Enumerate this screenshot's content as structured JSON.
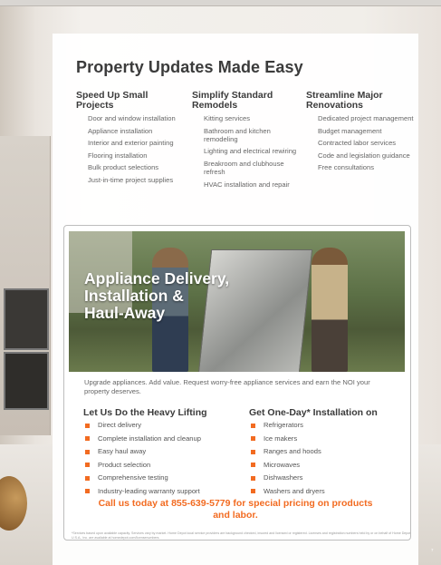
{
  "title": "Property Updates Made Easy",
  "columns": [
    {
      "heading": "Speed Up Small Projects",
      "items": [
        "Door and window installation",
        "Appliance installation",
        "Interior and exterior painting",
        "Flooring installation",
        "Bulk product selections",
        "Just-in-time project supplies"
      ]
    },
    {
      "heading": "Simplify Standard Remodels",
      "items": [
        "Kitting services",
        "Bathroom and kitchen remodeling",
        "Lighting and electrical rewiring",
        "Breakroom and clubhouse refresh",
        "HVAC installation and repair"
      ]
    },
    {
      "heading": "Streamline Major Renovations",
      "items": [
        "Dedicated project management",
        "Budget management",
        "Contracted labor services",
        "Code and legislation guidance",
        "Free consultations"
      ]
    }
  ],
  "feature": {
    "headline": [
      "Appliance Delivery,",
      "Installation &",
      "Haul-Away"
    ],
    "intro": "Upgrade appliances. Add value. Request worry-free appliance services and earn the NOI your property deserves.",
    "left": {
      "heading": "Let Us Do the Heavy Lifting",
      "items": [
        "Direct delivery",
        "Complete installation and cleanup",
        "Easy haul away",
        "Product selection",
        "Comprehensive testing",
        "Industry-leading warranty support"
      ]
    },
    "right": {
      "heading": "Get One-Day* Installation on",
      "items": [
        "Refrigerators",
        "Ice makers",
        "Ranges and hoods",
        "Microwaves",
        "Dishwashers",
        "Washers and dryers"
      ]
    },
    "cta": "Call us today at 855-639-5779 for special pricing on products and labor.",
    "disclaimer": "*Services based upon available capacity. Services vary by market. Home Depot local service providers are background checked, insured and licensed or registered. Licenses and registration numbers held by or on behalf of Home Depot U.S.A., Inc. are available at homedepot.com/licensenumbers."
  },
  "page_number": "7",
  "colors": {
    "accent": "#f26b21",
    "heading": "#3b3b3b",
    "body": "#666666"
  }
}
